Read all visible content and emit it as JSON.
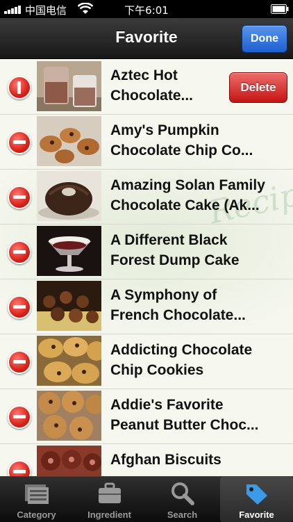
{
  "status_bar": {
    "carrier": "中国电信",
    "time": "下午6:01"
  },
  "nav": {
    "title": "Favorite",
    "done_label": "Done"
  },
  "watermark_text": "Recipes",
  "list": {
    "delete_label": "Delete",
    "items": [
      {
        "title": "Aztec Hot\nChocolate..."
      },
      {
        "title": "Amy's Pumpkin\nChocolate Chip Co..."
      },
      {
        "title": "Amazing Solan Family\nChocolate Cake (Ak..."
      },
      {
        "title": "A Different Black\nForest Dump Cake"
      },
      {
        "title": "A Symphony of\nFrench Chocolate..."
      },
      {
        "title": "Addicting Chocolate\nChip Cookies"
      },
      {
        "title": "Addie's Favorite\nPeanut Butter Choc..."
      },
      {
        "title": "Afghan Biscuits"
      }
    ]
  },
  "tabs": [
    {
      "label": "Category",
      "icon": "category-icon"
    },
    {
      "label": "Ingredient",
      "icon": "briefcase-icon"
    },
    {
      "label": "Search",
      "icon": "magnifier-icon"
    },
    {
      "label": "Favorite",
      "icon": "tag-icon",
      "active": true
    }
  ],
  "colors": {
    "delete": "#d42a22",
    "done": "#2f6fdc",
    "active_tab_icon": "#3a9be8"
  }
}
